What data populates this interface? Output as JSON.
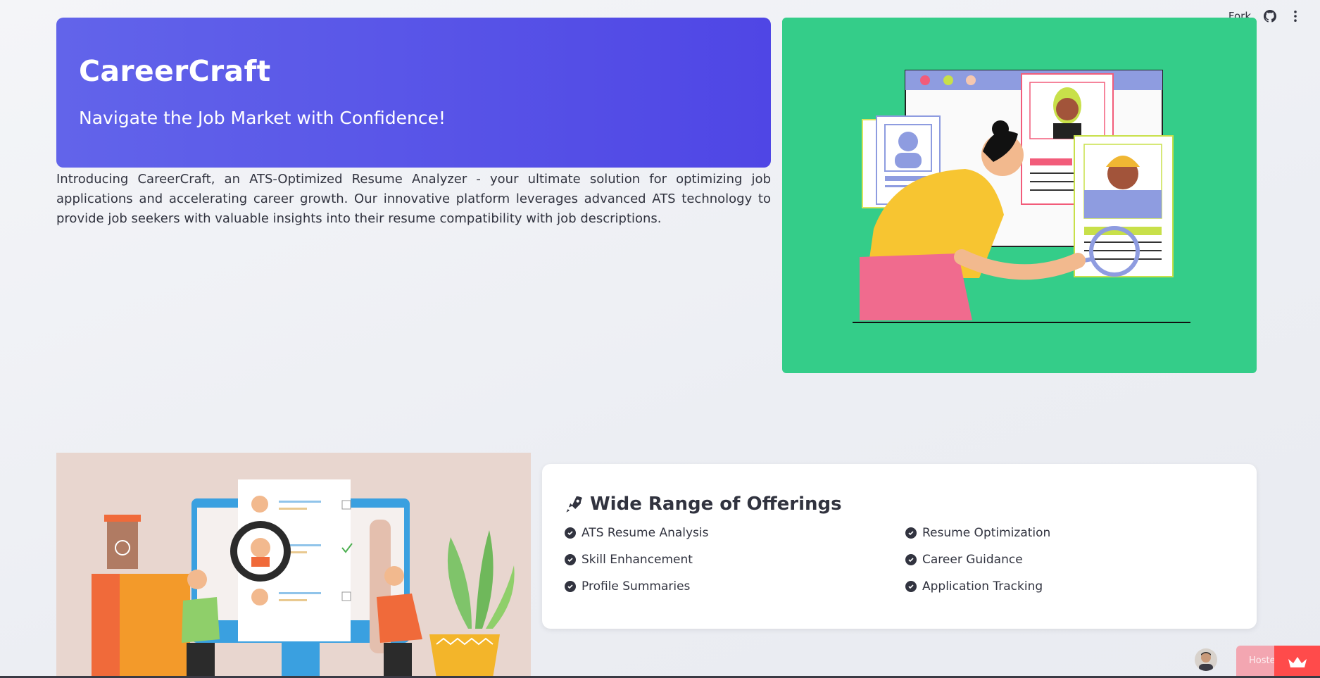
{
  "topbar": {
    "fork_label": "Fork"
  },
  "hero": {
    "title": "CareerCraft",
    "subtitle": "Navigate the Job Market with Confidence!",
    "intro": "Introducing CareerCraft, an ATS-Optimized Resume Analyzer - your ultimate solution for optimizing job applications and accelerating career growth. Our innovative platform leverages advanced ATS technology to provide job seekers with valuable insights into their resume compatibility with job descriptions."
  },
  "offerings": {
    "title": "Wide Range of Offerings",
    "items": [
      "ATS Resume Analysis",
      "Resume Optimization",
      "Skill Enhancement",
      "Career Guidance",
      "Profile Summaries",
      "Application Tracking"
    ]
  },
  "footer": {
    "hosted_label": "Hoste"
  },
  "colors": {
    "hero_start": "#6264ea",
    "hero_end": "#4f46e5",
    "illustration_green": "#34cd89",
    "streamlit_red": "#ff4b4b"
  }
}
